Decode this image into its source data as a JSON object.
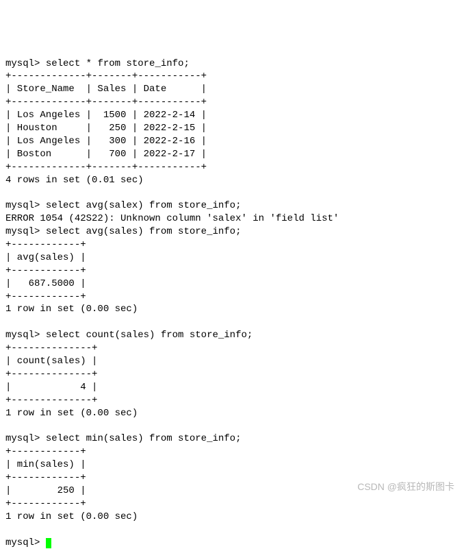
{
  "prompt": "mysql>",
  "queries": {
    "q1": "select * from store_info;",
    "q2": "select avg(salex) from store_info;",
    "q3": "select avg(sales) from store_info;",
    "q4": "select count(sales) from store_info;",
    "q5": "select min(sales) from store_info;"
  },
  "error": "ERROR 1054 (42S22): Unknown column 'salex' in 'field list'",
  "table1": {
    "border_top": "+-------------+-------+-----------+",
    "header": "| Store_Name  | Sales | Date      |",
    "border_mid": "+-------------+-------+-----------+",
    "r1": "| Los Angeles |  1500 | 2022-2-14 |",
    "r2": "| Houston     |   250 | 2022-2-15 |",
    "r3": "| Los Angeles |   300 | 2022-2-16 |",
    "r4": "| Boston      |   700 | 2022-2-17 |",
    "border_bot": "+-------------+-------+-----------+",
    "footer": "4 rows in set (0.01 sec)"
  },
  "table2": {
    "border_top": "+------------+",
    "header": "| avg(sales) |",
    "border_mid": "+------------+",
    "r1": "|   687.5000 |",
    "border_bot": "+------------+",
    "footer": "1 row in set (0.00 sec)"
  },
  "table3": {
    "border_top": "+--------------+",
    "header": "| count(sales) |",
    "border_mid": "+--------------+",
    "r1": "|            4 |",
    "border_bot": "+--------------+",
    "footer": "1 row in set (0.00 sec)"
  },
  "table4": {
    "border_top": "+------------+",
    "header": "| min(sales) |",
    "border_mid": "+------------+",
    "r1": "|        250 |",
    "border_bot": "+------------+",
    "footer": "1 row in set (0.00 sec)"
  },
  "watermark": "CSDN @疯狂的斯图卡",
  "chart_data": {
    "type": "table",
    "title": "store_info",
    "columns": [
      "Store_Name",
      "Sales",
      "Date"
    ],
    "rows": [
      [
        "Los Angeles",
        1500,
        "2022-2-14"
      ],
      [
        "Houston",
        250,
        "2022-2-15"
      ],
      [
        "Los Angeles",
        300,
        "2022-2-16"
      ],
      [
        "Boston",
        700,
        "2022-2-17"
      ]
    ],
    "aggregates": {
      "avg(sales)": 687.5,
      "count(sales)": 4,
      "min(sales)": 250
    }
  }
}
